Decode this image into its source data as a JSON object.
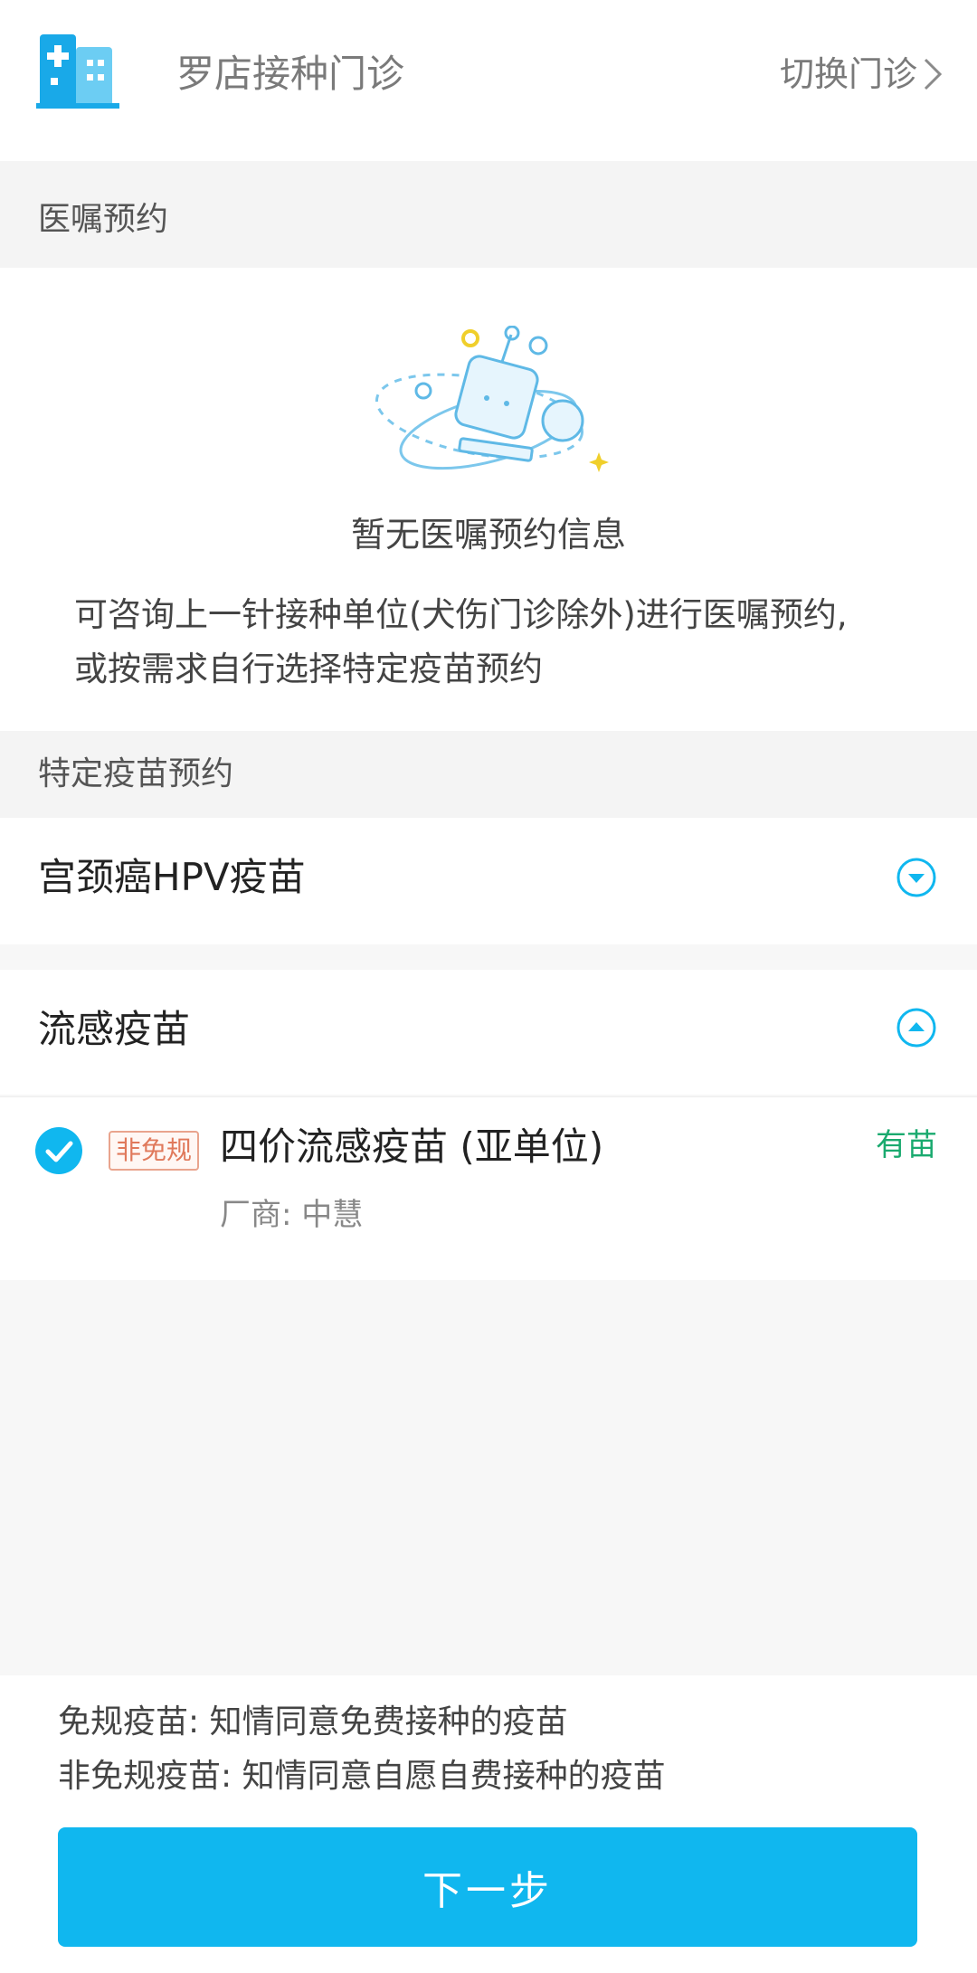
{
  "header": {
    "clinic_name": "罗店接种门诊",
    "switch_label": "切换门诊"
  },
  "medical_order": {
    "section_title": "医嘱预约",
    "empty_text": "暂无医嘱预约信息",
    "hint_line1": "可咨询上一针接种单位(犬伤门诊除外)进行医嘱预约,",
    "hint_line2": "或按需求自行选择特定疫苗预约"
  },
  "specific": {
    "section_title": "特定疫苗预约",
    "groups": [
      {
        "label": "宫颈癌HPV疫苗",
        "expanded": false
      },
      {
        "label": "流感疫苗",
        "expanded": true
      }
    ],
    "item": {
      "badge": "非免规",
      "name": "四价流感疫苗 (亚单位)",
      "stock": "有苗",
      "manufacturer": "厂商:  中慧",
      "checked": true
    }
  },
  "footer": {
    "legend1": "免规疫苗:  知情同意免费接种的疫苗",
    "legend2": "非免规疫苗:  知情同意自愿自费接种的疫苗",
    "next_label": "下一步"
  },
  "colors": {
    "accent": "#10b7ef",
    "stock_green": "#1aaa6f",
    "badge_orange": "#e0795b"
  }
}
